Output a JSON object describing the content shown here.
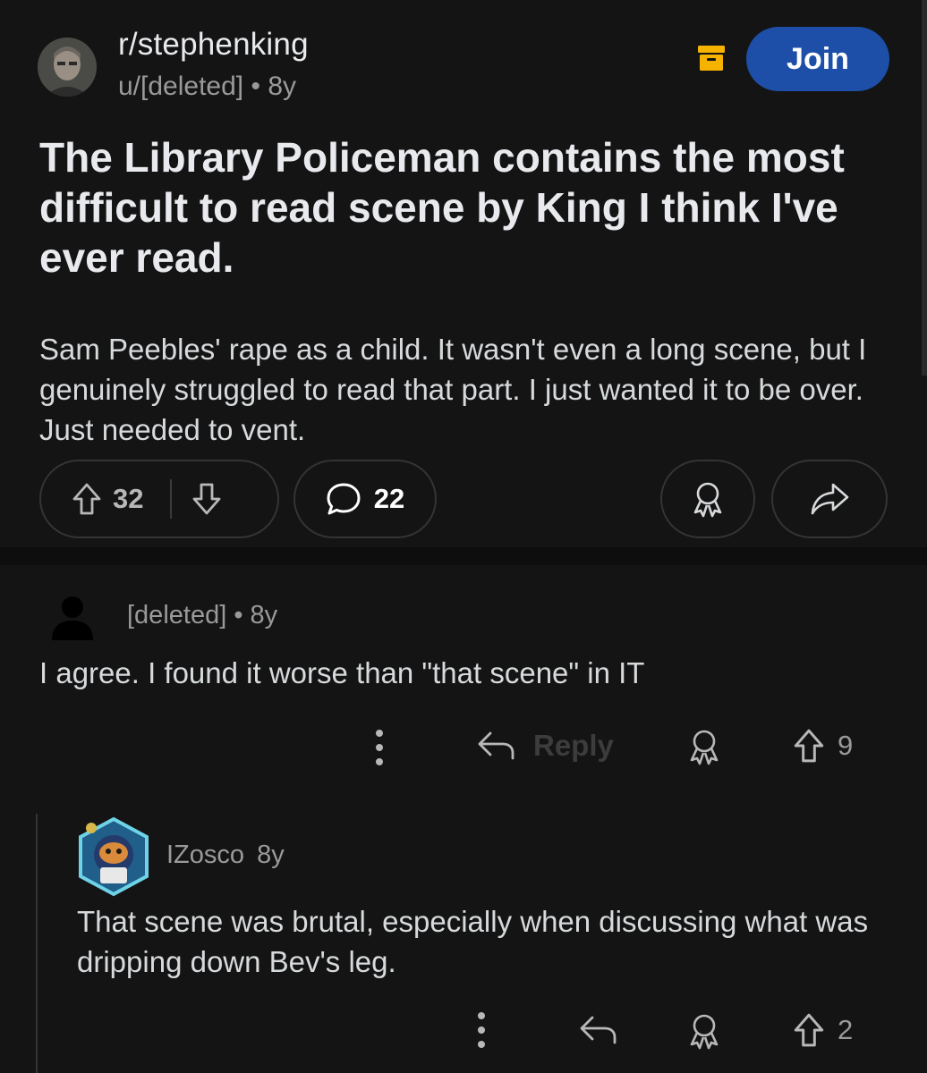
{
  "post": {
    "subreddit": "r/stephenking",
    "author": "u/[deleted]",
    "separator": "•",
    "age": "8y",
    "join_label": "Join",
    "title": "The Library Policeman contains the most difficult to read scene by King I think I've ever read.",
    "body": "Sam Peebles' rape as a child. It wasn't even a long scene, but I genuinely struggled to read that part. I just wanted it to be over. Just needed to vent.",
    "upvotes": "32",
    "comments_count": "22",
    "icons": [
      "archive-icon",
      "upvote-icon",
      "downvote-icon",
      "comment-icon",
      "award-icon",
      "share-icon"
    ],
    "colors": {
      "join_button": "#1d4fa8",
      "archive_icon": "#f5b300",
      "background": "#141414"
    }
  },
  "comments": [
    {
      "author": "[deleted]",
      "separator": "•",
      "age": "8y",
      "text": "I agree. I found it worse than \"that scene\" in IT",
      "reply_label": "Reply",
      "upvotes": "9"
    },
    {
      "author": "IZosco",
      "age": "8y",
      "text": "That scene was brutal, especially when discussing what was dripping down Bev's leg.",
      "upvotes": "2"
    }
  ]
}
